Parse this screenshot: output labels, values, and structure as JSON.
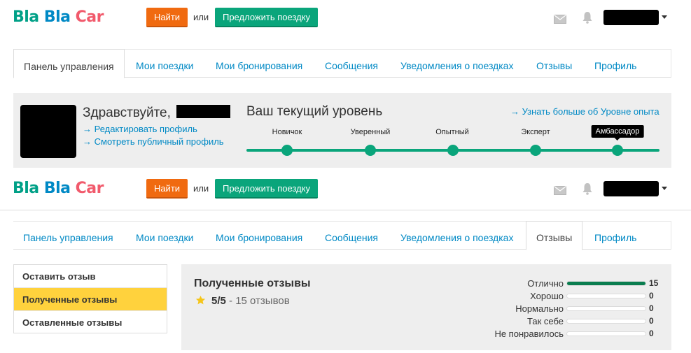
{
  "brand": {
    "part1": "Bla",
    "part2": "Bla",
    "part3": "Car"
  },
  "header": {
    "find_label": "Найти",
    "or_label": "или",
    "offer_label": "Предложить поездку"
  },
  "tabs": [
    {
      "label": "Панель управления"
    },
    {
      "label": "Мои поездки"
    },
    {
      "label": "Мои бронирования"
    },
    {
      "label": "Сообщения"
    },
    {
      "label": "Уведомления о поездках"
    },
    {
      "label": "Отзывы"
    },
    {
      "label": "Профиль"
    }
  ],
  "dashboard": {
    "greeting": "Здравствуйте,",
    "edit_profile_link": "→ Редактировать профиль",
    "public_profile_link": "→ Смотреть публичный профиль",
    "level_title": "Ваш текущий уровень",
    "level_more_link": "→ Узнать больше об Уровне опыта",
    "levels": [
      "Новичок",
      "Уверенный",
      "Опытный",
      "Эксперт",
      "Амбассадор"
    ],
    "current_level": "Амбассадор"
  },
  "reviews": {
    "menu": [
      {
        "label": "Оставить отзыв",
        "active": false
      },
      {
        "label": "Полученные отзывы",
        "active": true
      },
      {
        "label": "Оставленные отзывы",
        "active": false
      }
    ],
    "title": "Полученные отзывы",
    "score": "5/5",
    "count_text": "- 15 отзывов",
    "distribution": [
      {
        "label": "Отлично",
        "count": "15",
        "fraction": 1.0
      },
      {
        "label": "Хорошо",
        "count": "0",
        "fraction": 0
      },
      {
        "label": "Нормально",
        "count": "0",
        "fraction": 0
      },
      {
        "label": "Так себе",
        "count": "0",
        "fraction": 0
      },
      {
        "label": "Не понравилось",
        "count": "0",
        "fraction": 0
      }
    ]
  },
  "colors": {
    "find_button": "#f06a10",
    "offer_button": "#0aa57b",
    "link": "#0089c5",
    "active_menu": "#ffd23d",
    "bar_fill": "#0a7d4f"
  },
  "icons": {
    "mail": "mail-icon",
    "bell": "bell-icon",
    "star": "star-icon"
  }
}
